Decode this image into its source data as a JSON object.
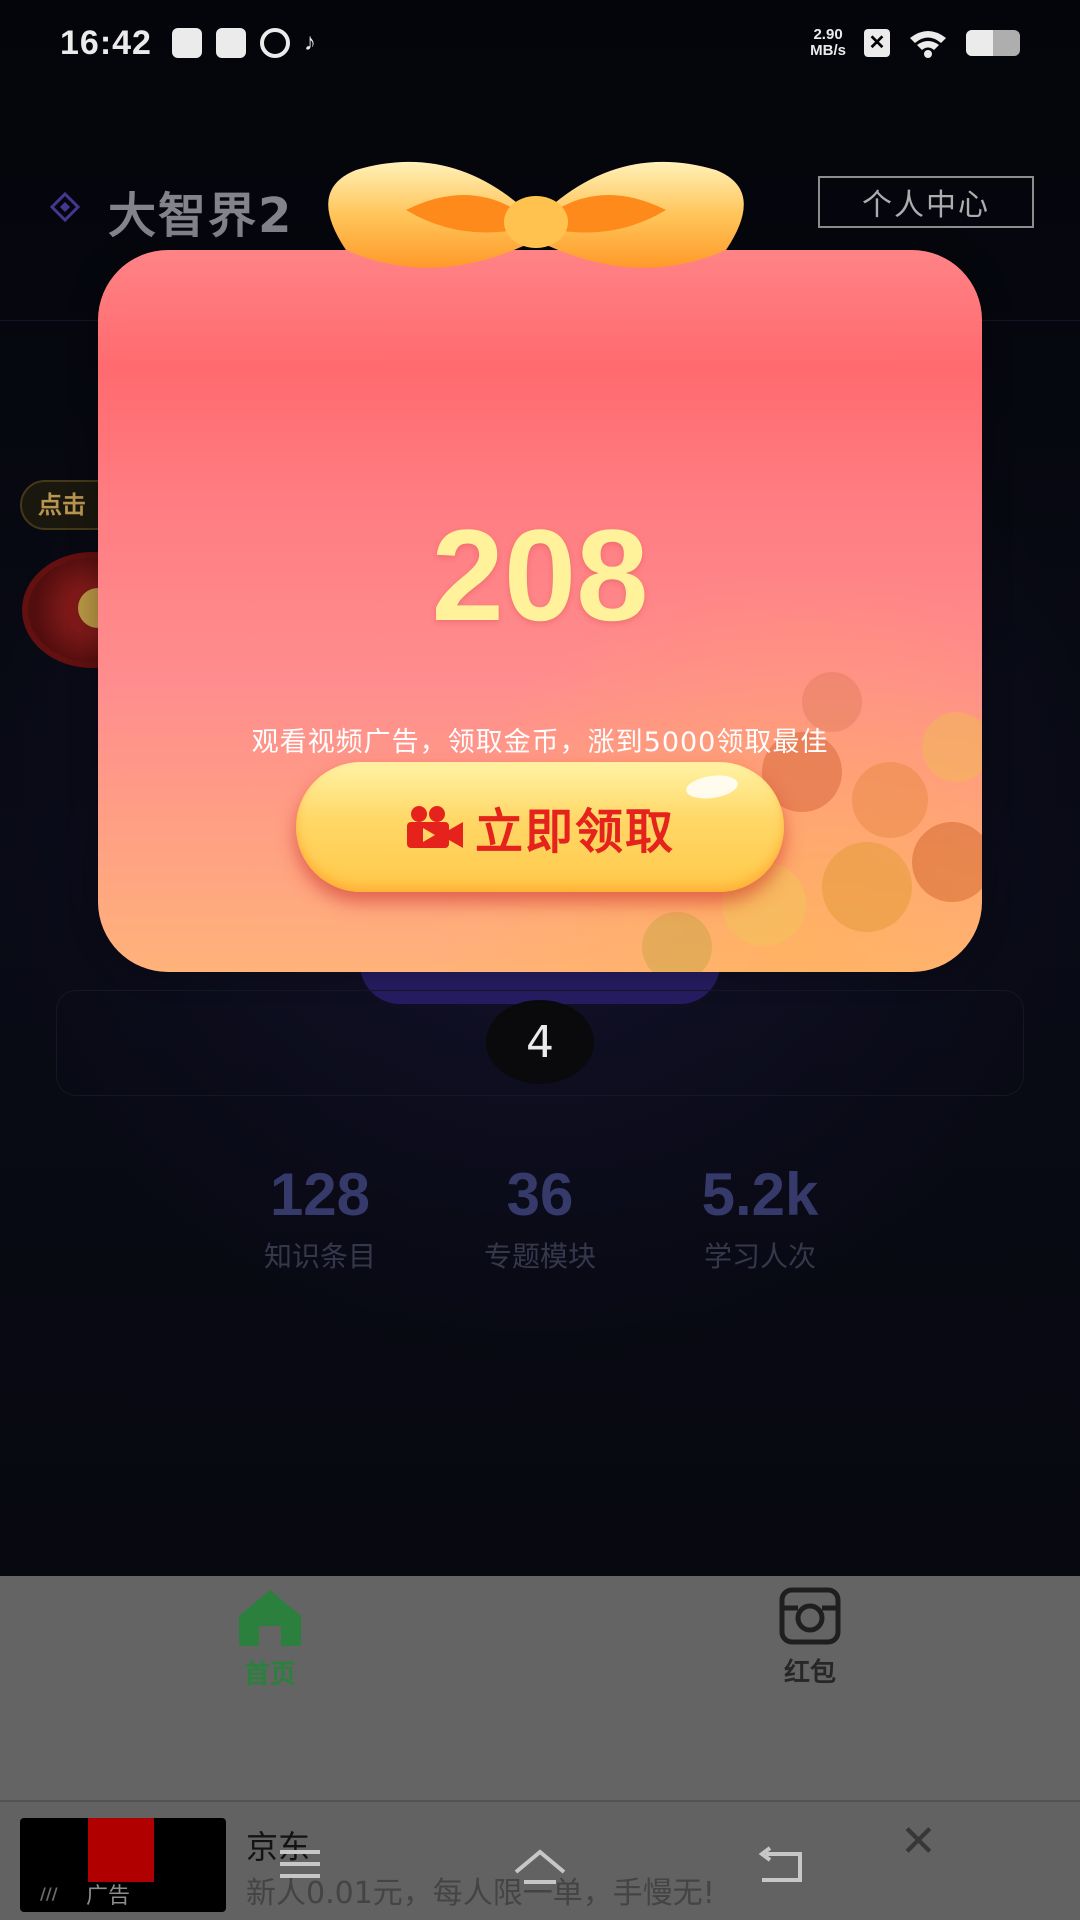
{
  "status_bar": {
    "time": "16:42",
    "net_speed_value": "2.90",
    "net_speed_unit": "MB/s"
  },
  "header": {
    "app_title": "大智界2",
    "profile_button": "个人中心"
  },
  "floating": {
    "click_tag": "点击"
  },
  "countdown": "4",
  "stats": [
    {
      "value": "128",
      "label": "知识条目"
    },
    {
      "value": "36",
      "label": "专题模块"
    },
    {
      "value": "5.2k",
      "label": "学习人次"
    }
  ],
  "bottom_nav": [
    {
      "label": "首页",
      "icon": "home-icon",
      "active": true
    },
    {
      "label": "红包",
      "icon": "camera-icon",
      "active": false
    }
  ],
  "ad": {
    "title": "京东",
    "description": "新人0.01元，每人限一单，手慢无!",
    "tag": "广告"
  },
  "popup": {
    "amount": "208",
    "description": "观看视频广告，领取金币，涨到5000领取最佳",
    "claim_button": "立即领取"
  },
  "colors": {
    "popup_top": "#ff5a5e",
    "amount_color": "#fff29b",
    "claim_text": "#e5231c",
    "nav_active": "#2f8b44"
  }
}
